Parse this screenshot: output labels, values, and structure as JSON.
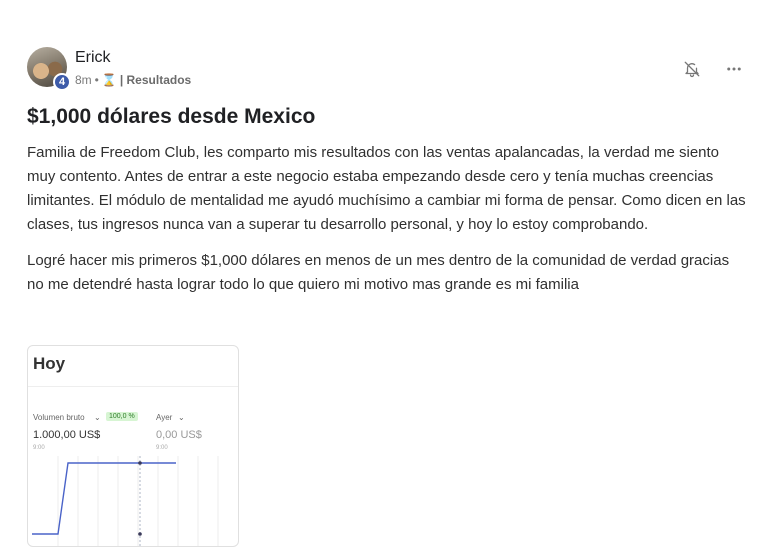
{
  "post": {
    "author": "Erick",
    "level": "4",
    "time_ago": "8m",
    "separator": "•",
    "category": "| Resultados",
    "title": "$1,000 dólares desde Mexico",
    "paragraphs": [
      "Familia de Freedom Club, les comparto mis resultados con las ventas apalancadas, la verdad me siento muy contento. Antes de entrar a este negocio estaba empezando desde cero y tenía muchas creencias limitantes. El módulo de mentalidad me ayudó muchísimo a cambiar mi forma de pensar. Como dicen en las clases, tus ingresos nunca van a superar tu desarrollo personal, y hoy lo estoy comprobando.",
      "Logré hacer mis primeros $1,000 dólares en menos de un mes dentro de la comunidad de verdad gracias no me detendré hasta lograr todo lo que quiero mi motivo mas grande es mi familia"
    ]
  },
  "icons": {
    "bell": "bell-off-icon",
    "more": "more-horizontal-icon",
    "category": "hourglass-icon"
  },
  "attachment": {
    "title": "Hoy",
    "gross_label": "Volumen bruto",
    "gross_pct": "100,0 %",
    "gross_value": "1.000,00 US$",
    "gross_time": "9:00",
    "compare_label": "Ayer",
    "compare_value": "0,00 US$",
    "compare_time": "9:00"
  },
  "colors": {
    "level_badge": "#3d5ba9",
    "chart_line": "#4a63c8",
    "pct_bg": "#d7f5d3"
  }
}
